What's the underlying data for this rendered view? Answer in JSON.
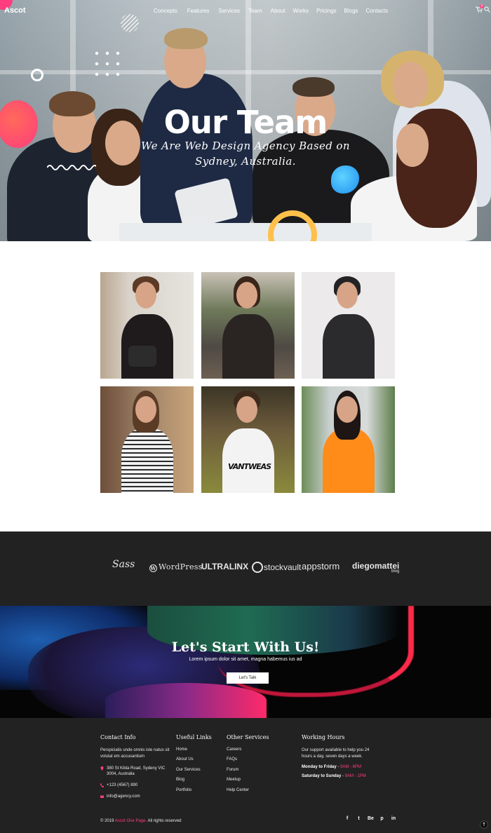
{
  "header": {
    "logo": "Ascot",
    "nav": [
      "Concepts",
      "Features",
      "Services",
      "Team",
      "About",
      "Works",
      "Pricings",
      "Blogs",
      "Contacts"
    ],
    "cart_count": "0"
  },
  "hero": {
    "title": "Our Team",
    "subtitle": "We Are Web Design Agency Based on Sydney, Australia."
  },
  "brands": {
    "sass": "Sass",
    "wordpress": "WordPress",
    "ultralinx": "ULTRALINX",
    "stockvault": "stockvault",
    "appstorm": "appstorm",
    "diegomattei": "diegomattei",
    "diegomattei_sub": "blog"
  },
  "cta": {
    "title": "Let's Start With Us!",
    "text": "Lorem ipsum dolor sit amet, magna habemus ius ad",
    "button": "Let's Talk"
  },
  "footer": {
    "contact": {
      "title": "Contact Info",
      "text": "Perspiciatis unde omnis iste natus sit volutat em accusantium",
      "address": "380 St Kilda Road, Sydeny VIC 3004, Australia",
      "phone": "+123 (4567) 890",
      "email": "info@agency.com"
    },
    "useful": {
      "title": "Useful Links",
      "links": [
        "Home",
        "About Us",
        "Our Services",
        "Blog",
        "Portfolio"
      ]
    },
    "services": {
      "title": "Other Services",
      "links": [
        "Careers",
        "FAQs",
        "Forum",
        "Meetup",
        "Help Center"
      ]
    },
    "hours": {
      "title": "Working Hours",
      "text": "Our support available to help you 24 hours a day, seven days a week.",
      "weekday_label": "Monday to Friday",
      "weekday_time": "9AM - 6PM",
      "weekend_label": "Saturday to Sunday",
      "weekend_time": "9AM - 1PM"
    },
    "copyright_prefix": "© 2019",
    "copyright_link": "Ascot One Page.",
    "copyright_suffix": "All rights reserved",
    "socials": [
      "f",
      "t",
      "Be",
      "p",
      "in"
    ]
  },
  "colors": {
    "accent": "#ff3c7d",
    "dark_bg": "#222222"
  }
}
